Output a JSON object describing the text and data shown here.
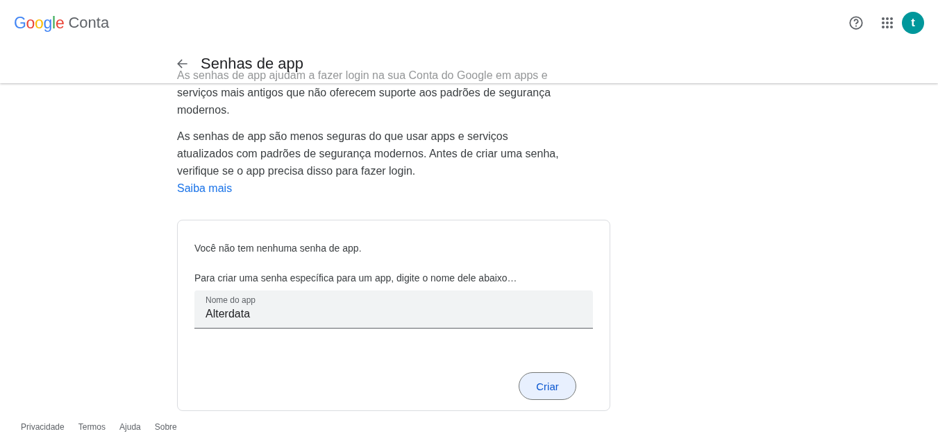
{
  "header": {
    "logo": "Google",
    "product": "Conta",
    "avatar": "t",
    "page_title": "Senhas de app"
  },
  "intro": [
    "As senhas de app ajudam a fazer login na sua Conta do Google em apps e serviços mais antigos que não oferecem suporte aos padrões de segurança modernos.",
    "As senhas de app são menos seguras do que usar apps e serviços atualizados com padrões de segurança modernos. Antes de criar uma senha, verifique se o app precisa disso para fazer login."
  ],
  "learn_more": "Saiba mais",
  "card": {
    "empty_message": "Você não tem nenhuma senha de app.",
    "instruction": "Para criar uma senha específica para um app, digite o nome dele abaixo…",
    "field": {
      "label": "Nome do app",
      "value": "Alterdata"
    },
    "button": "Criar"
  },
  "footer": [
    "Privacidade",
    "Termos",
    "Ajuda",
    "Sobre"
  ]
}
